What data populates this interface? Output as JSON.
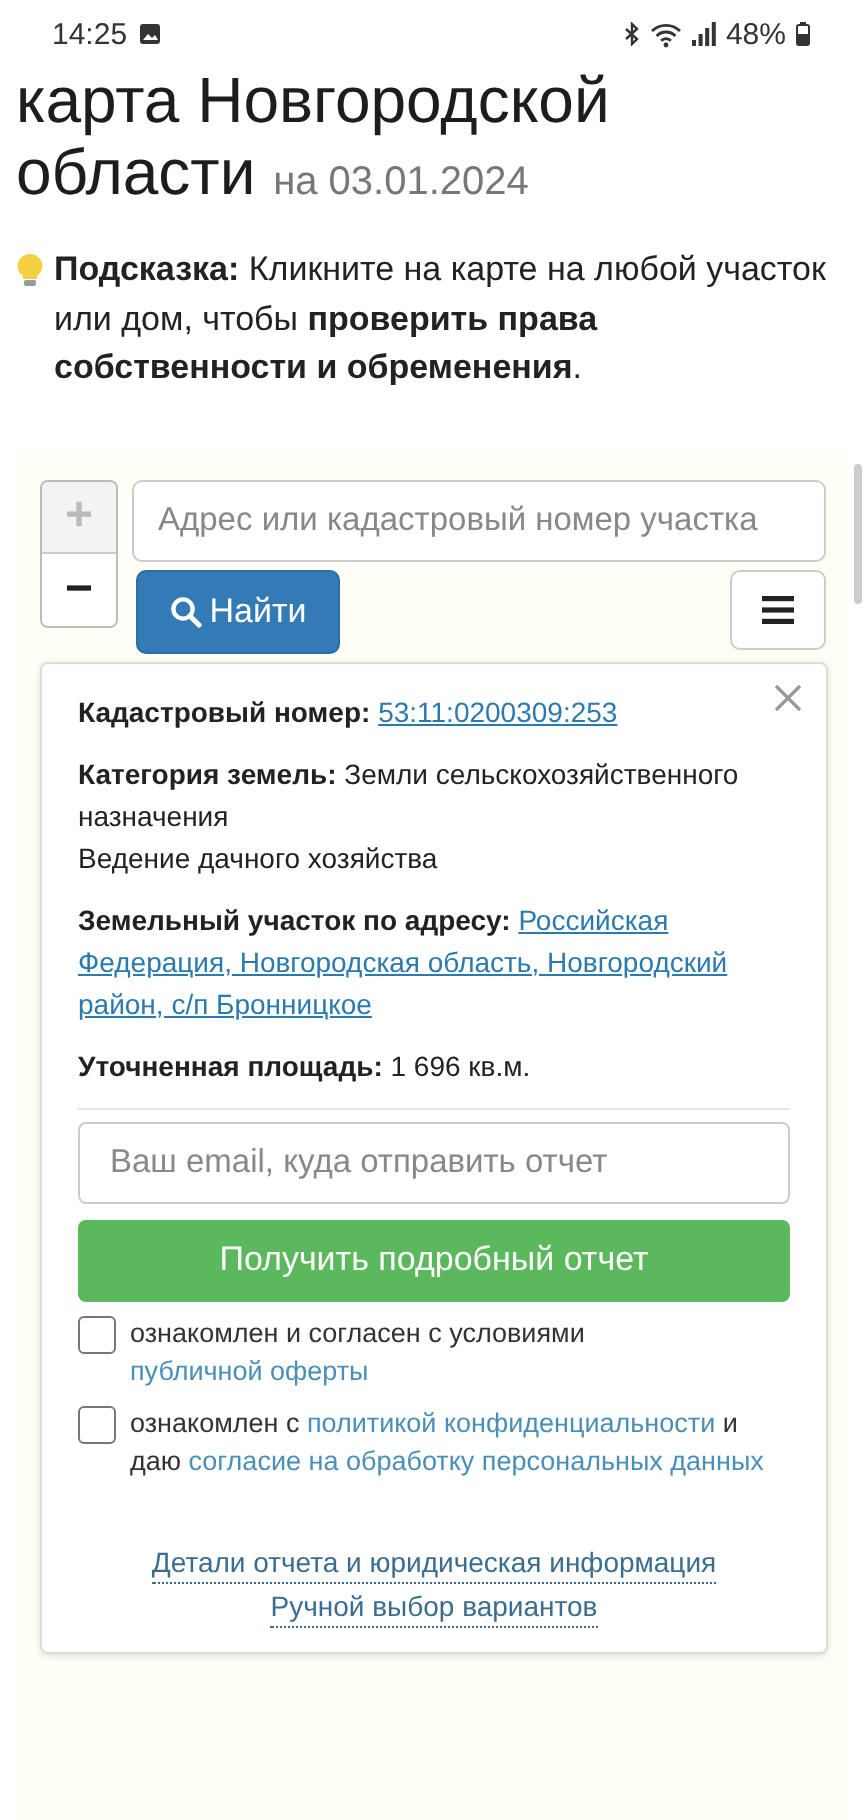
{
  "status_bar": {
    "time": "14:25",
    "battery": "48%"
  },
  "heading": {
    "title": "карта Новгородской области",
    "date": "на 03.01.2024"
  },
  "hint": {
    "text": "**Подсказка:** Кликните на карте на любой участок или дом, чтобы **проверить права собственности и обременения**."
  },
  "map": {
    "zoom": [
      {
        "label": "+",
        "disabled": true
      },
      {
        "label": "−",
        "disabled": false
      }
    ],
    "search": {
      "placeholder": "Адрес или кадастровый номер участка"
    },
    "find_button": "Найти",
    "popup": {
      "fields": [
        {
          "kind": "link",
          "label": "Кадастровый номер:",
          "value": "53:11:0200309:253"
        },
        {
          "kind": "text",
          "label": "Категория земель:",
          "value": "Земли сельскохозяйственного назначения",
          "note": "Ведение дачного хозяйства"
        },
        {
          "kind": "link",
          "label": "Земельный участок по адресу:",
          "value": "Российская Федерация, Новгородская область, Новгородский район, с/п Бронницкое"
        },
        {
          "kind": "text",
          "label": "Уточненная площадь:",
          "value": "1 696 кв.м."
        }
      ],
      "email": {
        "placeholder": "Ваш email, куда отправить отчет"
      },
      "submit_button": "Получить подробный отчет",
      "agreements": [
        {
          "checked": false,
          "parts": [
            {
              "text": "ознакомлен и согласен с условиями ",
              "link": false
            },
            {
              "text": "публичной оферты",
              "link": true
            }
          ]
        },
        {
          "checked": false,
          "parts": [
            {
              "text": "ознакомлен с ",
              "link": false
            },
            {
              "text": "политикой конфиденциальности",
              "link": true
            },
            {
              "text": " и даю ",
              "link": false
            },
            {
              "text": "согласие на обработку персональных данных",
              "link": true
            }
          ]
        }
      ],
      "footer_links": [
        "Детали отчета и юридическая информация",
        "Ручной выбор вариантов"
      ]
    }
  }
}
